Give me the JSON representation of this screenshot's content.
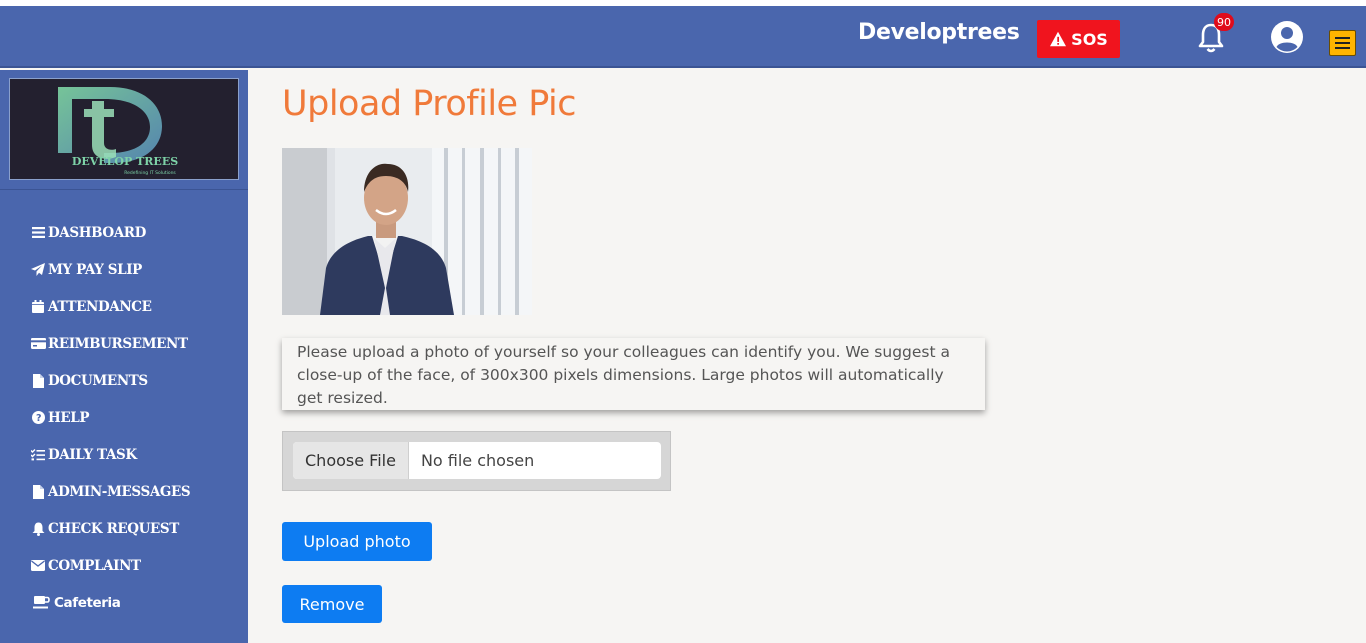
{
  "header": {
    "brand": "Developtrees",
    "sos_label": "SOS",
    "notification_count": "90"
  },
  "sidebar": {
    "logo_text": "DEVELOP TREES",
    "logo_tagline": "Redefining IT Solutions",
    "items": [
      {
        "label": "DASHBOARD",
        "icon": "bars-icon"
      },
      {
        "label": "MY PAY SLIP",
        "icon": "paper-plane-icon"
      },
      {
        "label": "ATTENDANCE",
        "icon": "calendar-icon"
      },
      {
        "label": "REIMBURSEMENT",
        "icon": "credit-card-icon"
      },
      {
        "label": "DOCUMENTS",
        "icon": "file-icon"
      },
      {
        "label": "HELP",
        "icon": "question-circle-icon"
      },
      {
        "label": "DAILY TASK",
        "icon": "task-list-icon"
      },
      {
        "label": "ADMIN-MESSAGES",
        "icon": "file-icon"
      },
      {
        "label": "CHECK REQUEST",
        "icon": "bell-icon"
      },
      {
        "label": "COMPLAINT",
        "icon": "envelope-icon"
      },
      {
        "label": "Cafeteria",
        "icon": "coffee-cup-icon"
      }
    ]
  },
  "main": {
    "title": "Upload Profile Pic",
    "info_text": "Please upload a photo of yourself so your colleagues can identify you. We suggest a close-up of the face, of 300x300 pixels dimensions. Large photos will automatically get resized.",
    "choose_file_label": "Choose File",
    "no_file_text": "No file chosen",
    "upload_button": "Upload photo",
    "remove_button": "Remove"
  }
}
